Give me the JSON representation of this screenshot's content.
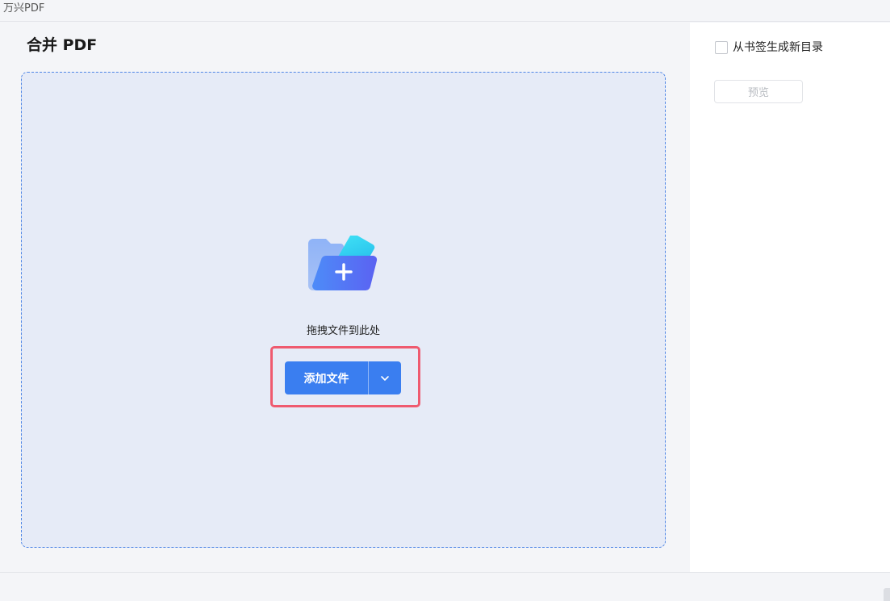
{
  "app": {
    "title": "万兴PDF"
  },
  "main": {
    "title": "合并 PDF",
    "dropzone": {
      "icon": "folder-add-icon",
      "hint": "拖拽文件到此处",
      "add_button_label": "添加文件",
      "dropdown_icon": "chevron-down-icon"
    }
  },
  "sidepanel": {
    "bookmark_checkbox_label": "从书签生成新目录",
    "bookmark_checked": false,
    "preview_button_label": "预览"
  },
  "colors": {
    "accent": "#3a7ef0",
    "highlight": "#ef5a6f",
    "dropzone_bg": "#e6ebf7",
    "dropzone_border": "#4f86e6"
  }
}
